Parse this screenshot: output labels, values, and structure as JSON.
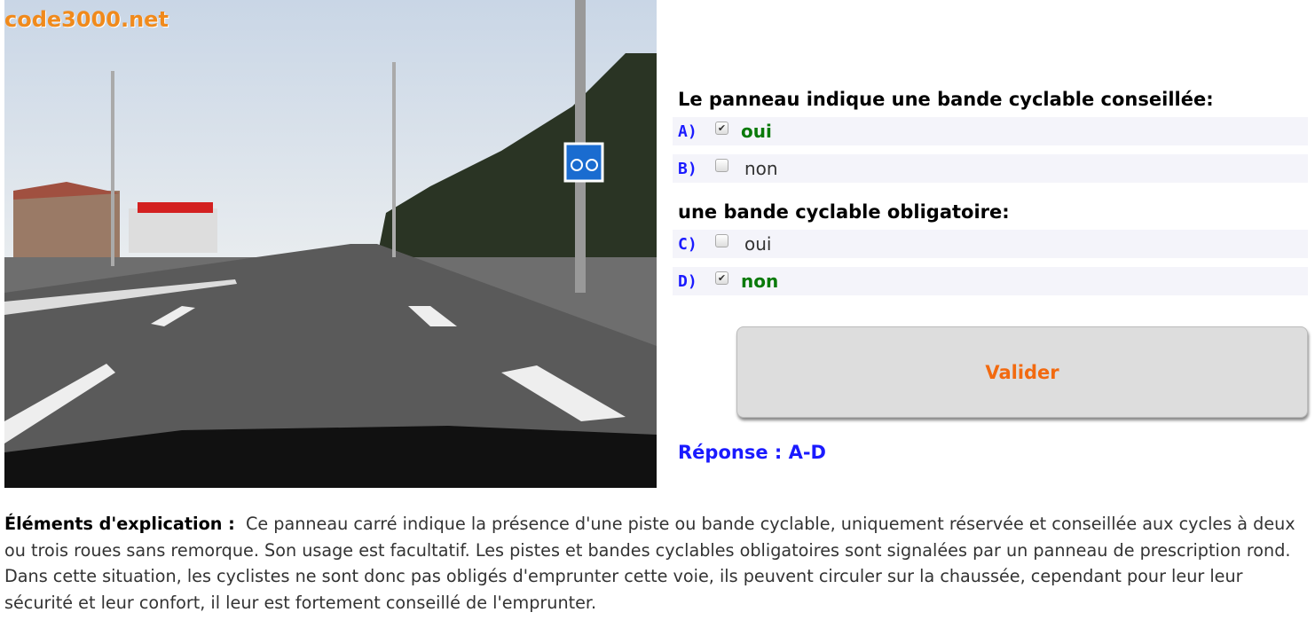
{
  "watermark": "code3000.net",
  "question1": "Le panneau indique une bande cyclable conseillée:",
  "question2": "une bande cyclable obligatoire:",
  "options": [
    {
      "letter": "A)",
      "label": "oui",
      "checked": true,
      "correct": true
    },
    {
      "letter": "B)",
      "label": "non",
      "checked": false,
      "correct": false
    },
    {
      "letter": "C)",
      "label": "oui",
      "checked": false,
      "correct": false
    },
    {
      "letter": "D)",
      "label": "non",
      "checked": true,
      "correct": true
    }
  ],
  "validate_label": "Valider",
  "answer": "Réponse : A-D",
  "explanation_title": "Éléments d'explication :",
  "explanation": "Ce panneau carré indique la présence d'une piste ou bande cyclable, uniquement réservée et conseillée aux cycles à deux ou trois roues sans remorque. Son usage est facultatif. Les pistes et bandes cyclables obligatoires sont signalées par un panneau de prescription rond. Dans cette situation, les cyclistes ne sont donc pas obligés d'emprunter cette voie, ils peuvent circuler sur la chaussée, cependant pour leur leur sécurité et leur confort, il leur est fortement conseillé de l'emprunter."
}
